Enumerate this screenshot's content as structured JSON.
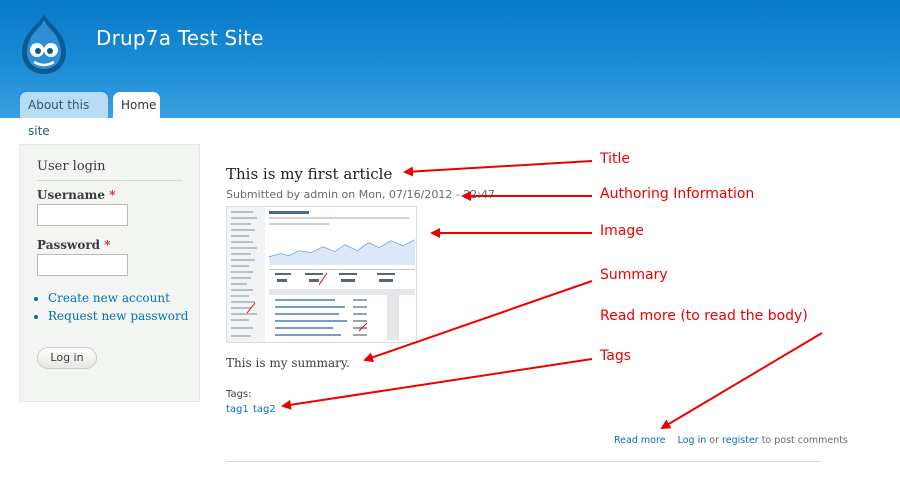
{
  "header": {
    "site_name": "Drup7a Test Site",
    "tabs": [
      {
        "label": "About this site",
        "active": false
      },
      {
        "label": "Home",
        "active": true
      }
    ],
    "accent_color": "#0879c9"
  },
  "sidebar": {
    "title": "User login",
    "username_label": "Username",
    "password_label": "Password",
    "required_mark": "*",
    "username_value": "",
    "password_value": "",
    "links": [
      "Create new account",
      "Request new password"
    ],
    "login_button": "Log in"
  },
  "article": {
    "title": "This is my first article",
    "submitted": "Submitted by admin on Mon, 07/16/2012 - 22:47",
    "summary": "This is my summary.",
    "tags_label": "Tags:",
    "tags": [
      "tag1",
      "tag2"
    ],
    "read_more": "Read more",
    "login_link": "Log in",
    "or_text": "or",
    "register_link": "register",
    "post_comments_text": "to post comments"
  },
  "annotations": [
    "Title",
    "Authoring Information",
    "Image",
    "Summary",
    "Read more (to read the body)",
    "Tags"
  ],
  "annotation_color": "#ee0000",
  "link_color": "#0071b3"
}
